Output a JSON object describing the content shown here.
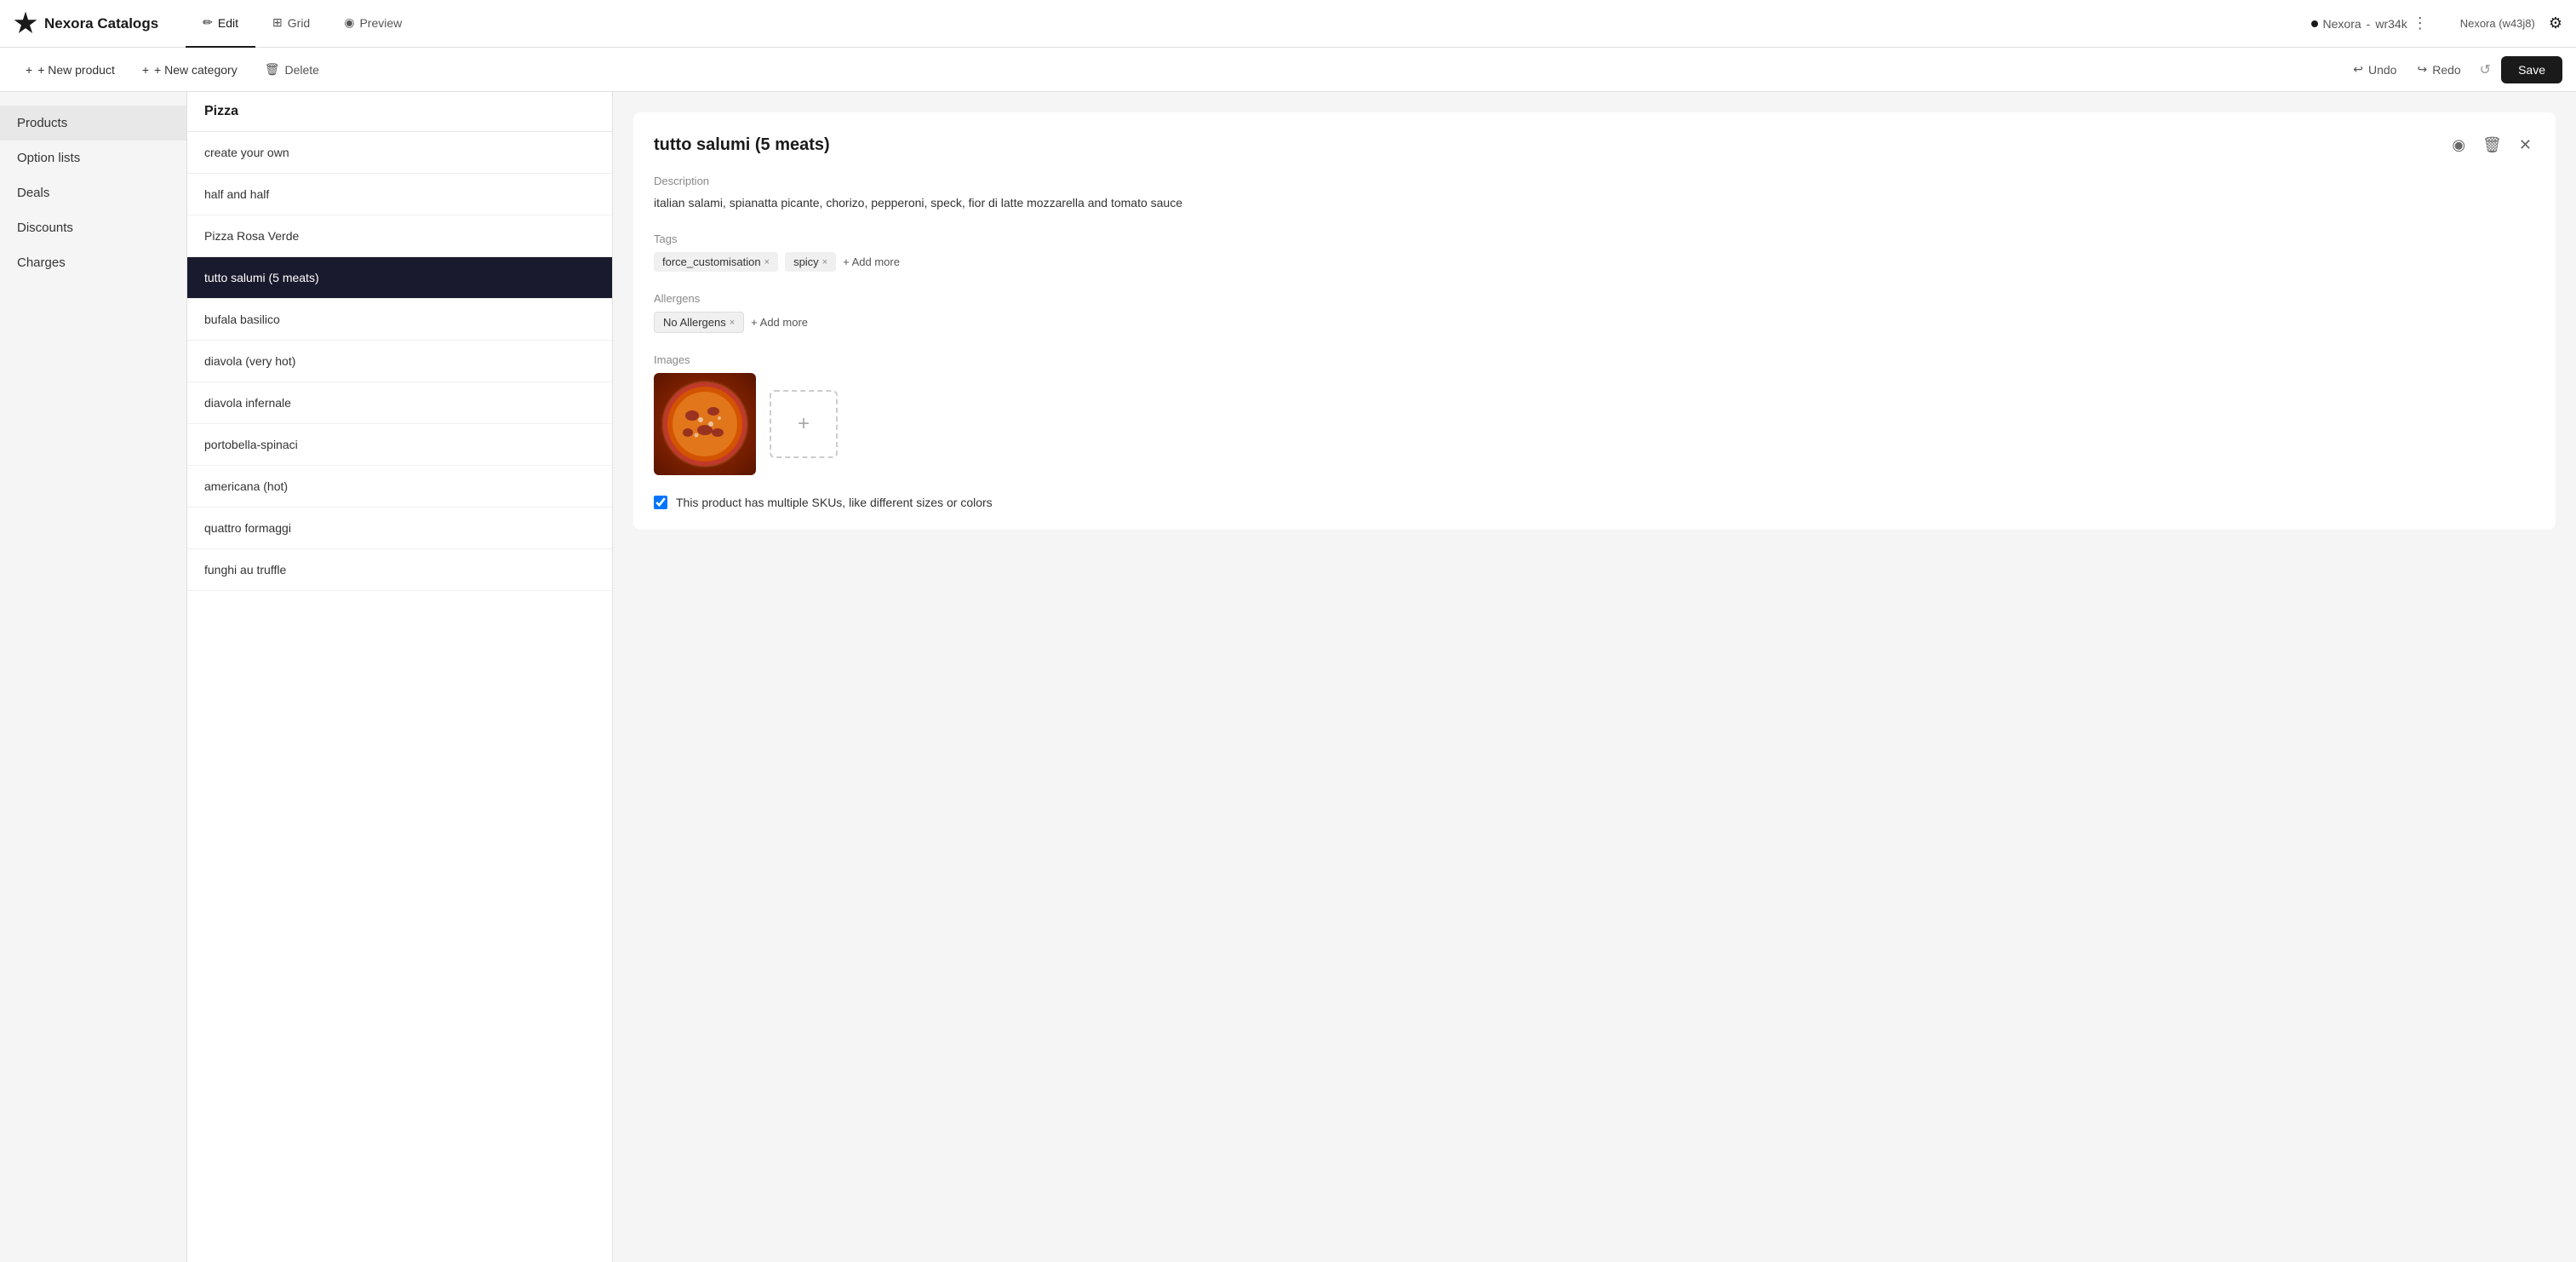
{
  "brand": {
    "name": "Nexora Catalogs"
  },
  "nav": {
    "tabs": [
      {
        "id": "edit",
        "label": "Edit",
        "active": true,
        "icon": "pencil"
      },
      {
        "id": "grid",
        "label": "Grid",
        "active": false,
        "icon": "grid"
      },
      {
        "id": "preview",
        "label": "Preview",
        "active": false,
        "icon": "eye"
      }
    ],
    "workspace": {
      "name": "Nexora",
      "code": "wr34k"
    },
    "user": "Nexora (w43j8)",
    "more_icon": "⋮",
    "settings_icon": "⚙"
  },
  "toolbar": {
    "new_product": "+ New product",
    "new_category": "+ New category",
    "delete": "Delete",
    "undo": "Undo",
    "redo": "Redo",
    "save": "Save"
  },
  "sidebar": {
    "items": [
      {
        "id": "products",
        "label": "Products",
        "active": true
      },
      {
        "id": "option-lists",
        "label": "Option lists",
        "active": false
      },
      {
        "id": "deals",
        "label": "Deals",
        "active": false
      },
      {
        "id": "discounts",
        "label": "Discounts",
        "active": false
      },
      {
        "id": "charges",
        "label": "Charges",
        "active": false
      }
    ]
  },
  "product_list": {
    "category": "Pizza",
    "items": [
      {
        "id": 1,
        "name": "create your own",
        "selected": false
      },
      {
        "id": 2,
        "name": "half and half",
        "selected": false
      },
      {
        "id": 3,
        "name": "Pizza Rosa Verde",
        "selected": false
      },
      {
        "id": 4,
        "name": "tutto salumi (5 meats)",
        "selected": true
      },
      {
        "id": 5,
        "name": "bufala basilico",
        "selected": false
      },
      {
        "id": 6,
        "name": "diavola (very hot)",
        "selected": false
      },
      {
        "id": 7,
        "name": "diavola infernale",
        "selected": false
      },
      {
        "id": 8,
        "name": "portobella-spinaci",
        "selected": false
      },
      {
        "id": 9,
        "name": "americana (hot)",
        "selected": false
      },
      {
        "id": 10,
        "name": "quattro formaggi",
        "selected": false
      },
      {
        "id": 11,
        "name": "funghi au truffle",
        "selected": false
      }
    ]
  },
  "detail": {
    "title": "tutto salumi (5 meats)",
    "description_label": "Description",
    "description": "italian salami, spianatta picante, chorizo, pepperoni, speck, fior di latte mozzarella and tomato sauce",
    "tags_label": "Tags",
    "tags": [
      {
        "id": 1,
        "label": "force_customisation"
      },
      {
        "id": 2,
        "label": "spicy"
      }
    ],
    "tags_add": "+ Add more",
    "allergens_label": "Allergens",
    "allergens": [
      {
        "id": 1,
        "label": "No Allergens"
      }
    ],
    "allergens_add": "+ Add more",
    "images_label": "Images",
    "sku_label": "This product has multiple SKUs, like different sizes or colors",
    "sku_checked": true,
    "icons": {
      "view": "👁",
      "delete": "🗑",
      "close": "✕",
      "eye": "◉",
      "trash": "⬜",
      "plus": "+"
    }
  }
}
